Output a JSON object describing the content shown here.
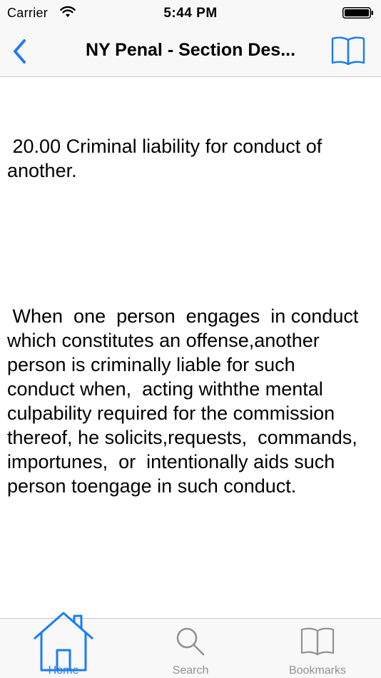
{
  "status_bar": {
    "carrier": "Carrier",
    "time": "5:44 PM",
    "wifi_icon": "wifi-icon",
    "battery_icon": "battery-icon"
  },
  "nav_bar": {
    "title": "NY Penal - Section Des...",
    "back_icon": "chevron-left-icon",
    "bookmark_icon": "book-open-icon"
  },
  "content": {
    "heading": " 20.00 Criminal liability for conduct of another.",
    "body": " When  one  person  engages  in conduct  which constitutes an offense,another person is criminally liable for such conduct when,  acting withthe mental culpability required for the commission thereof, he solicits,requests,  commands, importunes,  or  intentionally aids such person toengage in such conduct."
  },
  "tab_bar": {
    "tabs": [
      {
        "label": "Home",
        "icon": "home-icon",
        "active": true
      },
      {
        "label": "Search",
        "icon": "magnifier-icon",
        "active": false
      },
      {
        "label": "Bookmarks",
        "icon": "book-icon",
        "active": false
      }
    ]
  },
  "colors": {
    "accent": "#1a7cf5",
    "inactive": "#929292",
    "bar_background": "#f8f8f8"
  }
}
